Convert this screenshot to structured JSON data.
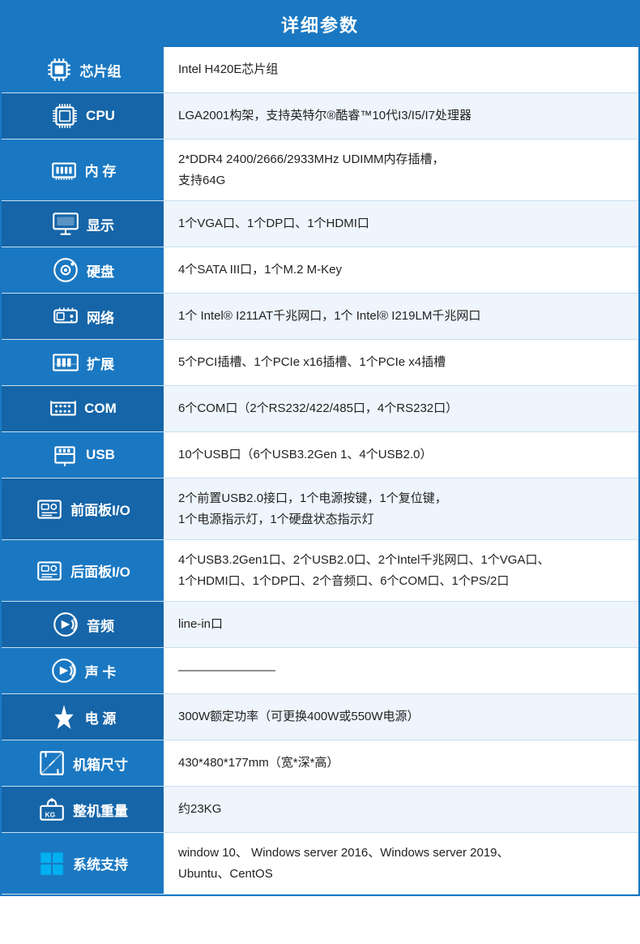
{
  "header": {
    "title": "详细参数"
  },
  "rows": [
    {
      "id": "chipset",
      "icon": "chipset",
      "label": "芯片组",
      "value": "Intel H420E芯片组"
    },
    {
      "id": "cpu",
      "icon": "cpu",
      "label": "CPU",
      "value": "LGA2001构架，支持英特尔®酷睿™10代I3/I5/I7处理器"
    },
    {
      "id": "memory",
      "icon": "memory",
      "label": "内 存",
      "value": "2*DDR4 2400/2666/2933MHz  UDIMM内存插槽，\n支持64G"
    },
    {
      "id": "display",
      "icon": "display",
      "label": "显示",
      "value": "1个VGA口、1个DP口、1个HDMI口"
    },
    {
      "id": "storage",
      "icon": "storage",
      "label": "硬盘",
      "value": "4个SATA III口，1个M.2 M-Key"
    },
    {
      "id": "network",
      "icon": "network",
      "label": "网络",
      "value": "1个 Intel® I211AT千兆网口，1个 Intel® I219LM千兆网口"
    },
    {
      "id": "expansion",
      "icon": "expansion",
      "label": "扩展",
      "value": "5个PCI插槽、1个PCIe x16插槽、1个PCIe x4插槽"
    },
    {
      "id": "com",
      "icon": "com",
      "label": "COM",
      "value": "6个COM口（2个RS232/422/485口，4个RS232口）"
    },
    {
      "id": "usb",
      "icon": "usb",
      "label": "USB",
      "value": "10个USB口（6个USB3.2Gen 1、4个USB2.0）"
    },
    {
      "id": "front-panel",
      "icon": "panel",
      "label": "前面板I/O",
      "value": "2个前置USB2.0接口，1个电源按键，1个复位键，\n1个电源指示灯，1个硬盘状态指示灯"
    },
    {
      "id": "rear-panel",
      "icon": "panel",
      "label": "后面板I/O",
      "value": "4个USB3.2Gen1口、2个USB2.0口、2个Intel千兆网口、1个VGA口、\n1个HDMI口、1个DP口、2个音频口、6个COM口、1个PS/2口"
    },
    {
      "id": "audio",
      "icon": "audio",
      "label": "音频",
      "value": "line-in口"
    },
    {
      "id": "soundcard",
      "icon": "audio",
      "label": "声 卡",
      "value": "————————"
    },
    {
      "id": "power",
      "icon": "power",
      "label": "电 源",
      "value": "300W额定功率（可更换400W或550W电源）"
    },
    {
      "id": "dimensions",
      "icon": "dimensions",
      "label": "机箱尺寸",
      "value": "430*480*177mm（宽*深*高）"
    },
    {
      "id": "weight",
      "icon": "weight",
      "label": "整机重量",
      "value": "约23KG"
    },
    {
      "id": "os",
      "icon": "os",
      "label": "系统支持",
      "value": "window 10、 Windows server 2016、Windows server 2019、\nUbuntu、CentOS"
    }
  ]
}
